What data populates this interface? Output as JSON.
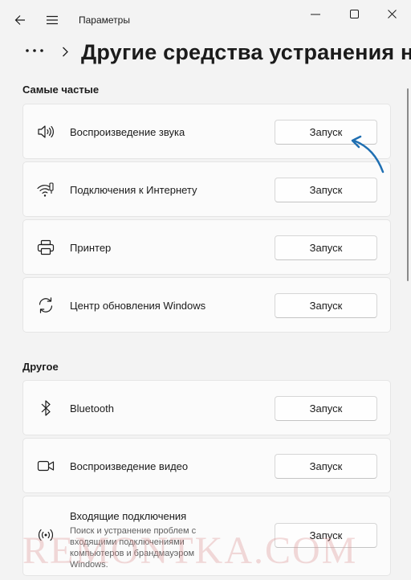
{
  "window": {
    "app_title": "Параметры"
  },
  "header": {
    "page_title": "Другие средства устранения не"
  },
  "sections": [
    {
      "title": "Самые частые",
      "items": [
        {
          "icon": "speaker-icon",
          "label": "Воспроизведение звука",
          "button": "Запуск"
        },
        {
          "icon": "wifi-icon",
          "label": "Подключения к Интернету",
          "button": "Запуск"
        },
        {
          "icon": "printer-icon",
          "label": "Принтер",
          "button": "Запуск"
        },
        {
          "icon": "sync-icon",
          "label": "Центр обновления Windows",
          "button": "Запуск"
        }
      ]
    },
    {
      "title": "Другое",
      "items": [
        {
          "icon": "bluetooth-icon",
          "label": "Bluetooth",
          "button": "Запуск"
        },
        {
          "icon": "video-camera-icon",
          "label": "Воспроизведение видео",
          "button": "Запуск"
        },
        {
          "icon": "incoming-signal-icon",
          "label": "Входящие подключения",
          "description": "Поиск и устранение проблем с входящими подключениями компьютеров и брандмауэром Windows.",
          "button": "Запуск"
        }
      ]
    }
  ],
  "watermark": "REMONTKA.COM",
  "colors": {
    "background": "#f3f3f3",
    "card": "#fbfbfb",
    "annotation_arrow": "#1f6fb2"
  }
}
